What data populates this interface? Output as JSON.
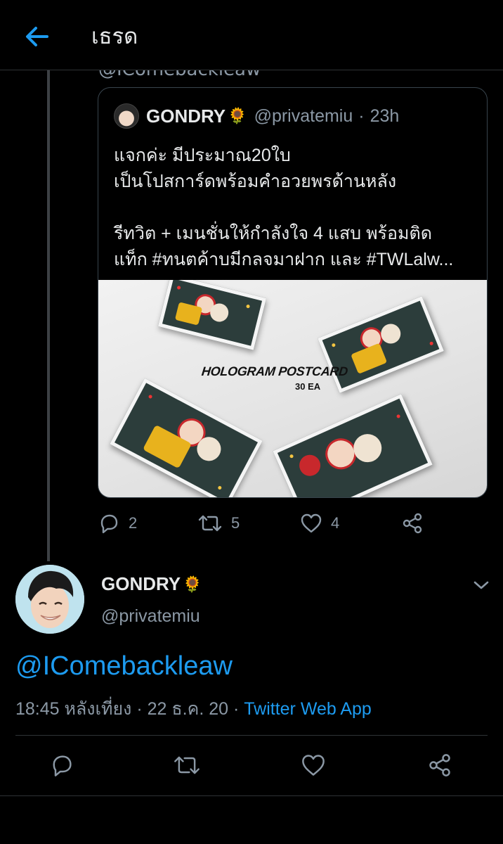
{
  "header": {
    "title": "เธรด",
    "back_icon": "arrow-left-icon"
  },
  "previous_reply_cut_text": "@IComebackleaw",
  "quote": {
    "name": "GONDRY",
    "name_emoji": "🌻",
    "handle": "@privatemiu",
    "time": "23h",
    "separator": "·",
    "lines": [
      "แจกค่ะ มีประมาณ20ใบ",
      "เป็นโปสการ์ดพร้อมคำอวยพรด้านหลัง",
      "",
      "รีทวิต + เมนชั่นให้กำลังใจ 4 แสบ พร้อมติด",
      "แท็ก #ทนตค้าบมีกลจมาฝาก และ #TWLalw..."
    ],
    "image": {
      "title": "HOLOGRAM POSTCARD",
      "subtitle": "30 EA"
    }
  },
  "quote_actions": {
    "reply_count": "2",
    "retweet_count": "5",
    "like_count": "4"
  },
  "tweet": {
    "name": "GONDRY",
    "name_emoji": "🌻",
    "handle": "@privatemiu",
    "mention": "@IComebackleaw",
    "time": "18:45 หลังเที่ยง",
    "date": "22 ธ.ค. 20",
    "separator": "·",
    "source": "Twitter Web App"
  },
  "colors": {
    "accent": "#1d9bf0",
    "background": "#000000",
    "muted": "#8b98a5",
    "border": "#2f3336"
  }
}
